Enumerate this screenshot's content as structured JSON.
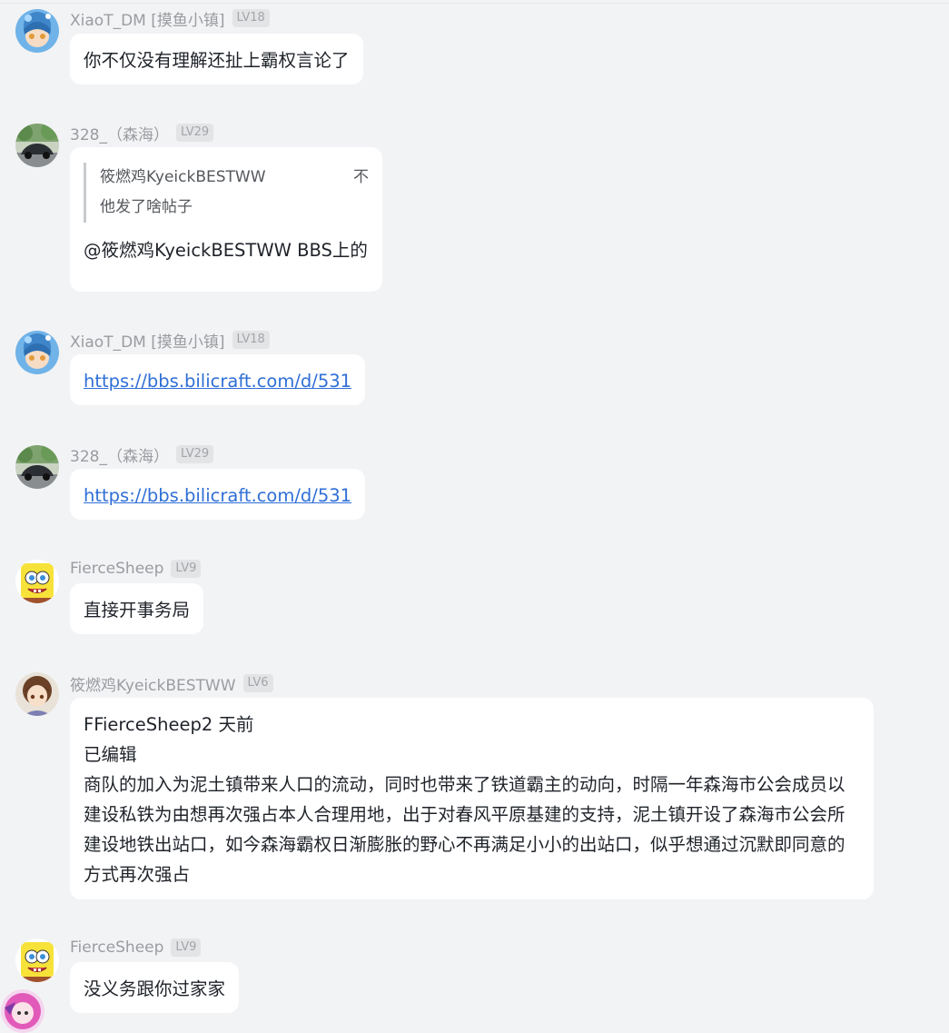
{
  "messages": [
    {
      "nick": "XiaoT_DM [摸鱼小镇]",
      "level": "LV18",
      "avatar": "anime-girl-blue-hair-avatar",
      "text": "你不仅没有理解还扯上霸权言论了"
    },
    {
      "nick": "328_（森海）",
      "level": "LV29",
      "avatar": "car-avatar",
      "quote": {
        "author": "筱燃鸡KyeickBESTWW",
        "trailing": "不",
        "text": "他发了啥帖子"
      },
      "text": "@筱燃鸡KyeickBESTWW BBS上的"
    },
    {
      "nick": "XiaoT_DM [摸鱼小镇]",
      "level": "LV18",
      "avatar": "anime-girl-blue-hair-avatar",
      "link": "https://bbs.bilicraft.com/d/531"
    },
    {
      "nick": "328_（森海）",
      "level": "LV29",
      "avatar": "car-avatar",
      "link": "https://bbs.bilicraft.com/d/531"
    },
    {
      "nick": "FierceSheep",
      "level": "LV9",
      "avatar": "spongebob-avatar",
      "text": "直接开事务局"
    },
    {
      "nick": "筱燃鸡KyeickBESTWW",
      "level": "LV6",
      "avatar": "anime-girl-brown-hair-avatar",
      "lines": [
        "FFierceSheep2 天前",
        "已编辑",
        "商队的加入为泥土镇带来人口的流动，同时也带来了铁道霸主的动向，时隔一年森海市公会成员以建设私铁为由想再次强占本人合理用地，出于对春风平原基建的支持，泥土镇开设了森海市公会所建设地铁出站口，如今森海霸权日渐膨胀的野心不再满足小小的出站口，似乎想通过沉默即同意的方式再次强占"
      ]
    },
    {
      "nick": "FierceSheep",
      "level": "LV9",
      "avatar": "spongebob-avatar",
      "text": "没义务跟你过家家"
    }
  ],
  "colors": {
    "background": "#f2f3f5",
    "bubble": "#ffffff",
    "link": "#2f6fd6",
    "nick": "#9a9ca0"
  }
}
